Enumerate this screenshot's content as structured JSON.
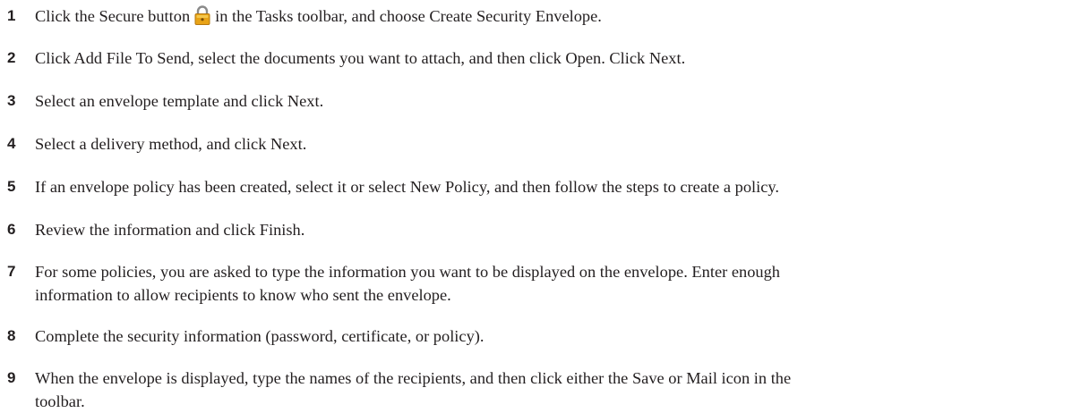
{
  "steps": [
    {
      "number": "1",
      "text_before": "Click the Secure button",
      "icon": "lock-icon",
      "text_after": "in the Tasks toolbar, and choose Create Security Envelope."
    },
    {
      "number": "2",
      "text": "Click Add File To Send, select the documents you want to attach, and then click Open. Click Next."
    },
    {
      "number": "3",
      "text": "Select an envelope template and click Next."
    },
    {
      "number": "4",
      "text": "Select a delivery method, and click Next."
    },
    {
      "number": "5",
      "text": "If an envelope policy has been created, select it or select New Policy, and then follow the steps to create a policy."
    },
    {
      "number": "6",
      "text": "Review the information and click Finish."
    },
    {
      "number": "7",
      "text_line1": "For some policies, you are asked to type the information you want to be displayed on the envelope. Enter enough",
      "text_line2": "information to allow recipients to know who sent the envelope."
    },
    {
      "number": "8",
      "text": "Complete the security information (password, certificate, or policy)."
    },
    {
      "number": "9",
      "text_line1": "When the envelope is displayed, type the names of the recipients, and then click either the Save or Mail icon in the",
      "text_line2": "toolbar."
    }
  ],
  "colors": {
    "text": "#231f20",
    "lock_body": "#e8a317",
    "lock_shackle": "#8a8a8a"
  }
}
